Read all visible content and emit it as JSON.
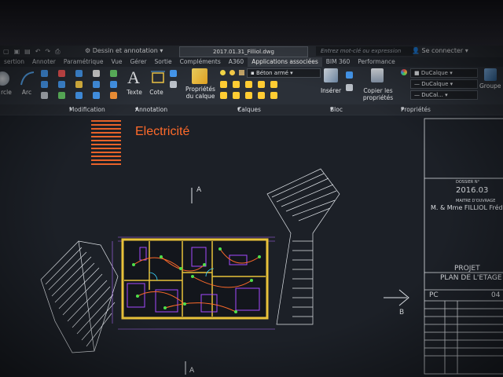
{
  "title_bar": {
    "workspace": "Dessin et annotation",
    "file_name": "2017.01.31_Filliol.dwg",
    "search_placeholder": "Entrez mot-clé ou expression",
    "sign_in": "Se connecter"
  },
  "tabs": [
    "sertion",
    "Annoter",
    "Paramétrique",
    "Vue",
    "Gérer",
    "Sortie",
    "Compléments",
    "A360",
    "Applications associées",
    "BIM 360",
    "Performance"
  ],
  "ribbon": {
    "draw": {
      "circle": "rcle",
      "arc": "Arc"
    },
    "annotation": {
      "text": "Texte",
      "dim": "Cote"
    },
    "layers": {
      "properties": "Propriétés du calque",
      "current_layer": "Béton armé"
    },
    "block": {
      "insert": "Insérer"
    },
    "properties": {
      "copy": "Copier les propriétés",
      "color": "DuCalque",
      "linetype": "DuCalque",
      "lineweight": "DuCal..."
    },
    "groups": "Groupe"
  },
  "panels": {
    "modification": "Modification",
    "annotation": "Annotation",
    "calques": "Calques",
    "bloc": "Bloc",
    "proprietes": "Propriétés"
  },
  "drawing": {
    "title": "Electricité",
    "section_a_top": "A",
    "section_a_bottom": "A",
    "section_b": "B",
    "cartouche": {
      "dossier": "DOSSIER N°",
      "year": "2016.03",
      "client_label": "MAITRE D'OUVRAGE",
      "client": "M. & Mme FILLIOL Frédéric",
      "projet_label": "PROJET",
      "projet": "PLAN DE L'ETAGE",
      "phase": "PC",
      "planche": "04"
    }
  },
  "colors": {
    "accent": "#ff6a2a",
    "wall": "#e8c23a",
    "purple": "#a64bff",
    "line": "#dfe3e8"
  }
}
